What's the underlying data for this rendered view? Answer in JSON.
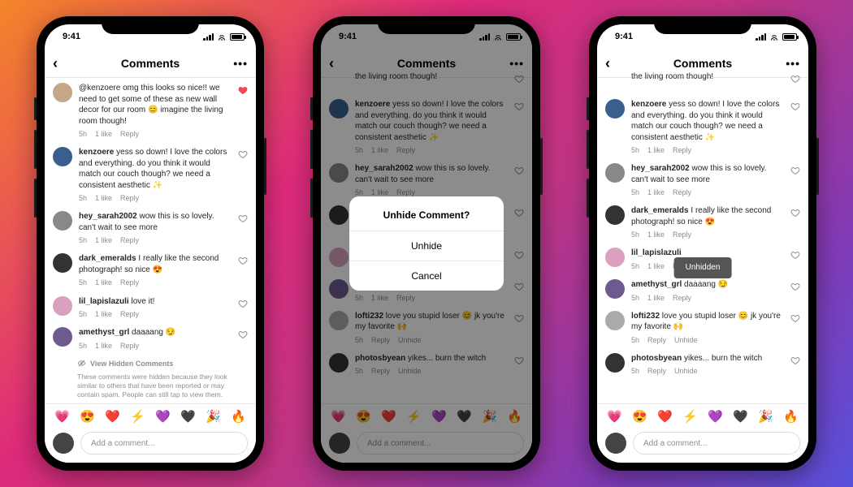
{
  "status_time": "9:41",
  "nav_title": "Comments",
  "dialog": {
    "title": "Unhide Comment?",
    "confirm": "Unhide",
    "cancel": "Cancel"
  },
  "toast": "Unhidden",
  "composer_placeholder": "Add a comment...",
  "emojis": [
    "💗",
    "😍",
    "❤️",
    "⚡",
    "💜",
    "🖤",
    "🎉",
    "🔥"
  ],
  "hidden_section": {
    "label": "View Hidden Comments",
    "desc": "These comments were hidden because they look similar to others that have been reported or may contain spam. People can still tap to view them."
  },
  "comments_a": [
    {
      "user": "",
      "tail": "@kenzoere omg this looks so nice!! we need to get some of these as new wall decor for our room 😊 imagine the living room though!",
      "time": "5h",
      "likes": "1 like",
      "reply": "Reply",
      "liked": true,
      "avatar": "#c4a688"
    },
    {
      "user": "kenzoere",
      "tail": " yess so down! I love the colors and everything. do you think it would match our couch though? we need a consistent aesthetic ✨",
      "time": "5h",
      "likes": "1 like",
      "reply": "Reply",
      "avatar": "#3a5f8f"
    },
    {
      "user": "hey_sarah2002",
      "tail": " wow this is so lovely. can't wait to see more",
      "time": "5h",
      "likes": "1 like",
      "reply": "Reply",
      "avatar": "#888"
    },
    {
      "user": "dark_emeralds",
      "tail": " I really like the second photograph! so nice 😍",
      "time": "5h",
      "likes": "1 like",
      "reply": "Reply",
      "avatar": "#333"
    },
    {
      "user": "lil_lapislazuli",
      "tail": " love it!",
      "time": "5h",
      "likes": "1 like",
      "reply": "Reply",
      "avatar": "#d9a0c0"
    },
    {
      "user": "amethyst_grl",
      "tail": " daaaang 😏",
      "time": "5h",
      "likes": "1 like",
      "reply": "Reply",
      "avatar": "#6d5a8f"
    }
  ],
  "comments_b": [
    {
      "user": "",
      "tail": "the living room though!",
      "time": "",
      "likes": "",
      "reply": "",
      "avatar": "transparent"
    },
    {
      "user": "kenzoere",
      "tail": " yess so down! I love the colors and everything. do you think it would match our couch though? we need a consistent aesthetic ✨",
      "time": "5h",
      "likes": "1 like",
      "reply": "Reply",
      "avatar": "#3a5f8f"
    },
    {
      "user": "hey_sarah2002",
      "tail": " wow this is so lovely. can't wait to see more",
      "time": "5h",
      "likes": "1 like",
      "reply": "Reply",
      "avatar": "#888"
    },
    {
      "user": "dark_emeralds",
      "tail": " I really like the second photograph! so nice 😍",
      "time": "5h",
      "likes": "1 like",
      "reply": "Reply",
      "avatar": "#333"
    },
    {
      "user": "lil_lapislazuli",
      "tail": " ",
      "time": "5h",
      "likes": "1 like",
      "reply": "Reply",
      "avatar": "#d9a0c0"
    },
    {
      "user": "amethyst_grl",
      "tail": " daaaang 😏",
      "time": "5h",
      "likes": "1 like",
      "reply": "Reply",
      "avatar": "#6d5a8f"
    },
    {
      "user": "lofti232",
      "tail": " love you stupid loser 😊 jk you're my favorite 🙌",
      "time": "5h",
      "likes": "",
      "reply": "Reply",
      "unhide": "Unhide",
      "avatar": "#aaa"
    },
    {
      "user": "photosbyean",
      "tail": " yikes... burn the witch",
      "time": "5h",
      "likes": "",
      "reply": "Reply",
      "unhide": "Unhide",
      "avatar": "#333"
    }
  ]
}
